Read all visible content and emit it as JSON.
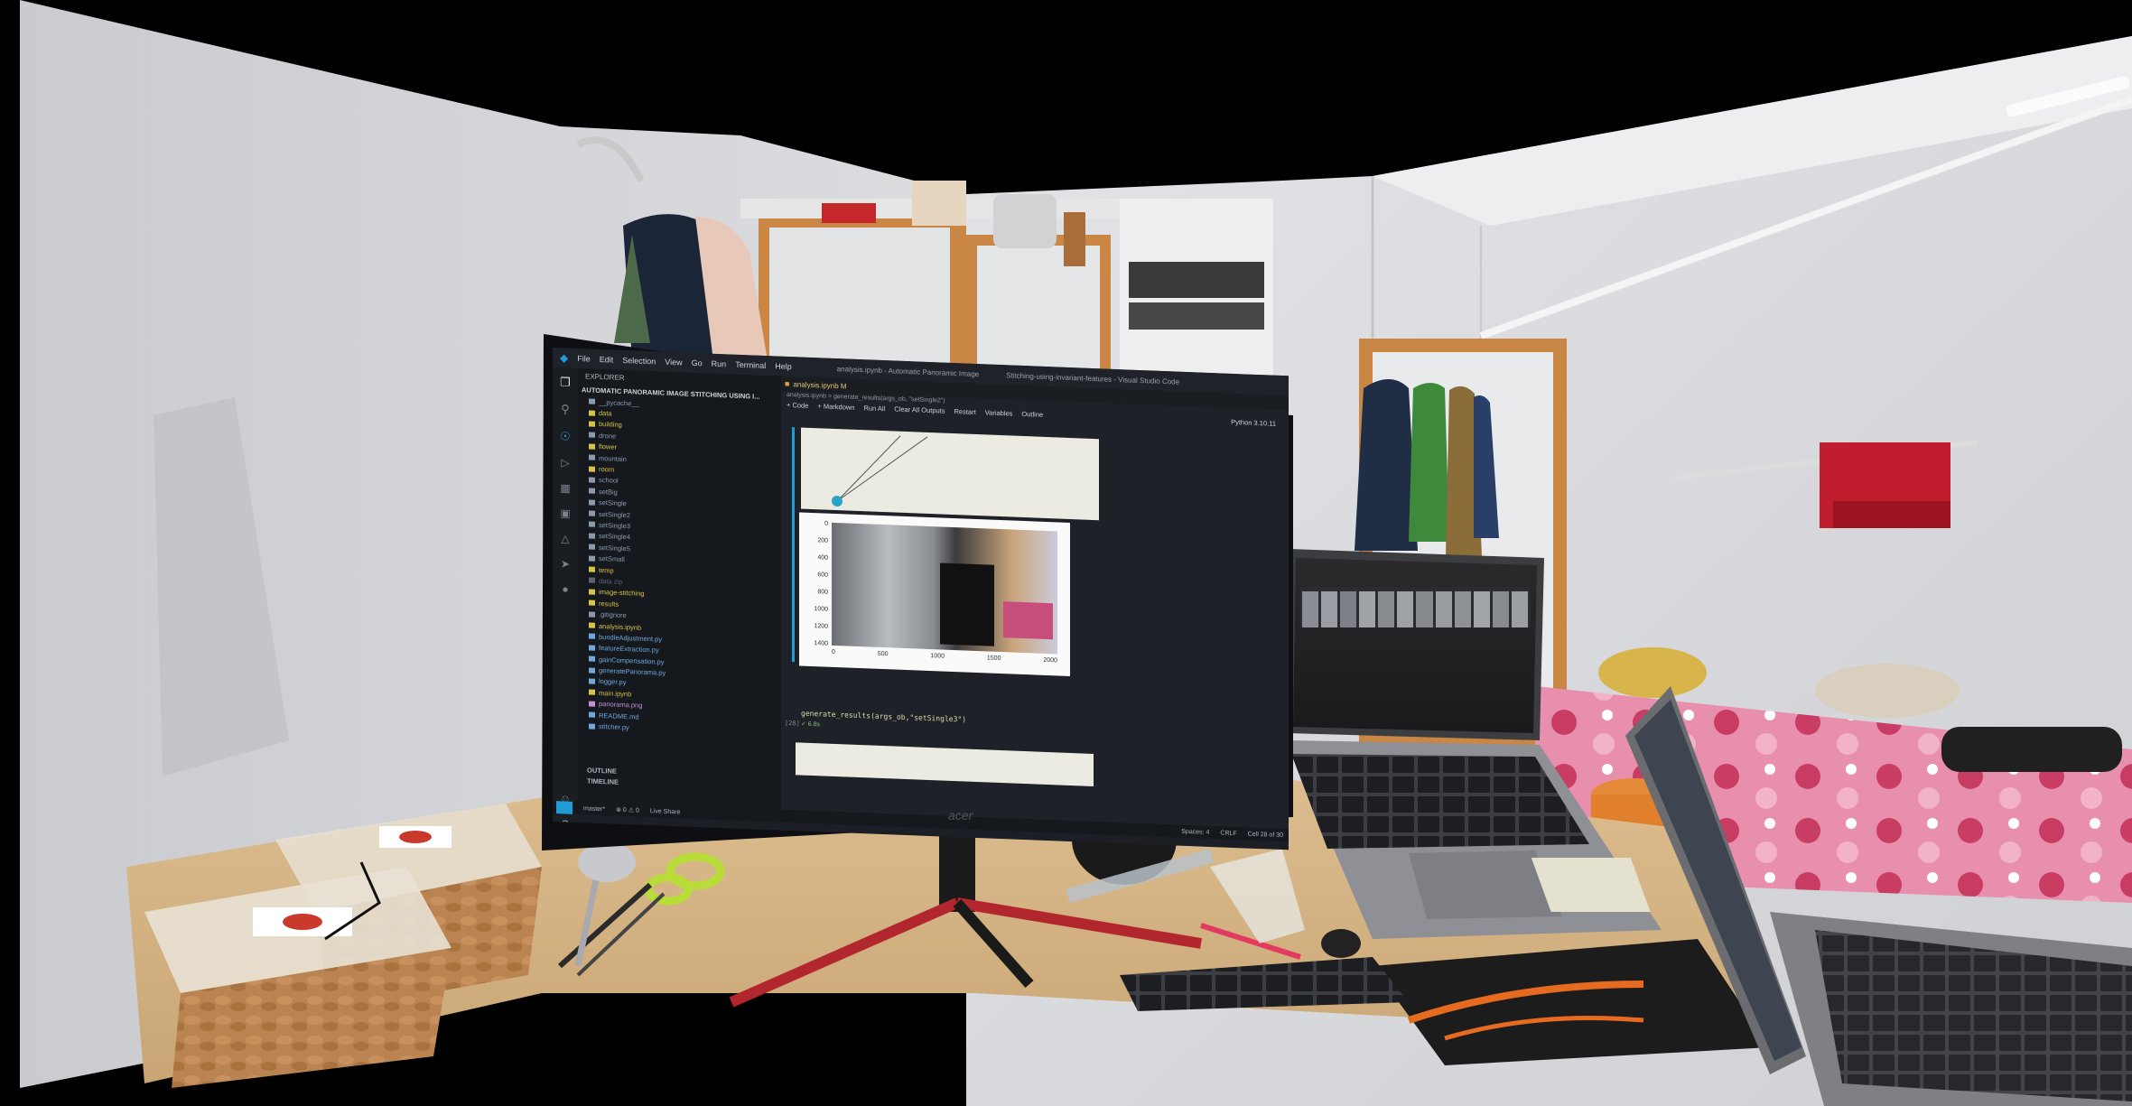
{
  "menu": {
    "items": [
      "File",
      "Edit",
      "Selection",
      "View",
      "Go",
      "Run",
      "Terminal",
      "Help"
    ],
    "title_left": "analysis.ipynb - Automatic Panoramic Image",
    "title_right": "Stitching-using-invariant-features - Visual Studio Code"
  },
  "explorer": {
    "header": "EXPLORER",
    "project": "AUTOMATIC PANORAMIC IMAGE STITCHING USING I...",
    "items": [
      {
        "label": "__pycache__",
        "color": "#8a9bb0"
      },
      {
        "label": "data",
        "color": "#d7c24a"
      },
      {
        "label": "building",
        "color": "#d7c24a"
      },
      {
        "label": "drone",
        "color": "#8a9bb0"
      },
      {
        "label": "flower",
        "color": "#d7c24a"
      },
      {
        "label": "mountain",
        "color": "#8a9bb0"
      },
      {
        "label": "room",
        "color": "#d7c24a"
      },
      {
        "label": "school",
        "color": "#8a9bb0"
      },
      {
        "label": "setBig",
        "color": "#8a9bb0"
      },
      {
        "label": "setSingle",
        "color": "#8a9bb0"
      },
      {
        "label": "setSingle2",
        "color": "#8a9bb0"
      },
      {
        "label": "setSingle3",
        "color": "#8a9bb0"
      },
      {
        "label": "setSingle4",
        "color": "#8a9bb0"
      },
      {
        "label": "setSingle5",
        "color": "#8a9bb0"
      },
      {
        "label": "setSmall",
        "color": "#8a9bb0"
      },
      {
        "label": "temp",
        "color": "#d7c24a"
      },
      {
        "label": "data.zip",
        "color": "#5a6473"
      },
      {
        "label": "image-stitching",
        "color": "#d7c24a"
      },
      {
        "label": "results",
        "color": "#d7c24a"
      },
      {
        "label": ".gitignore",
        "color": "#8a9bb0"
      },
      {
        "label": "analysis.ipynb",
        "color": "#d7c24a"
      },
      {
        "label": "bundleAdjustment.py",
        "color": "#6fa8dc"
      },
      {
        "label": "featureExtraction.py",
        "color": "#6fa8dc"
      },
      {
        "label": "gainCompensation.py",
        "color": "#6fa8dc"
      },
      {
        "label": "generatePanorama.py",
        "color": "#6fa8dc"
      },
      {
        "label": "logger.py",
        "color": "#6fa8dc"
      },
      {
        "label": "main.ipynb",
        "color": "#d7c24a"
      },
      {
        "label": "panorama.png",
        "color": "#c58fd6"
      },
      {
        "label": "README.md",
        "color": "#6fa8dc"
      },
      {
        "label": "stitcher.py",
        "color": "#6fa8dc"
      }
    ],
    "outline": "OUTLINE",
    "timeline": "TIMELINE"
  },
  "editor": {
    "tab_label": "analysis.ipynb M",
    "breadcrumb": "analysis.ipynb > generate_results(args_ob, \"setSingle2\")",
    "toolbar": [
      "+ Code",
      "+ Markdown",
      "Run All",
      "Clear All Outputs",
      "Restart",
      "Variables",
      "Outline"
    ],
    "kernel": "Python 3.10.11",
    "code_line": "generate_results(args_ob,\"setSingle3\")",
    "exec_status": "✓ 6.8s",
    "cell_index": "[28]",
    "y_ticks": [
      "0",
      "200",
      "400",
      "600",
      "800",
      "1000",
      "1200",
      "1400"
    ],
    "x_ticks": [
      "0",
      "500",
      "1000",
      "1500",
      "2000"
    ]
  },
  "status_bar": {
    "left": [
      "master*",
      "⊗ 0 ⚠ 0",
      "Live Share"
    ],
    "right": [
      "Spaces: 4",
      "CRLF",
      "Cell 28 of 30"
    ]
  },
  "colors": {
    "wall": "#d9dadc",
    "ceiling": "#e6e7e9",
    "desk": "#d8b888",
    "vscode_bg": "#1b1e24",
    "sidebar_bg": "#15181d",
    "accent": "#1f9cd6",
    "monitor_stand_red": "#b2262e"
  },
  "icons": [
    "explorer-icon",
    "search-icon",
    "source-control-icon",
    "run-debug-icon",
    "extensions-icon",
    "remote-icon",
    "testing-icon",
    "live-share-icon",
    "account-icon",
    "settings-gear-icon"
  ]
}
